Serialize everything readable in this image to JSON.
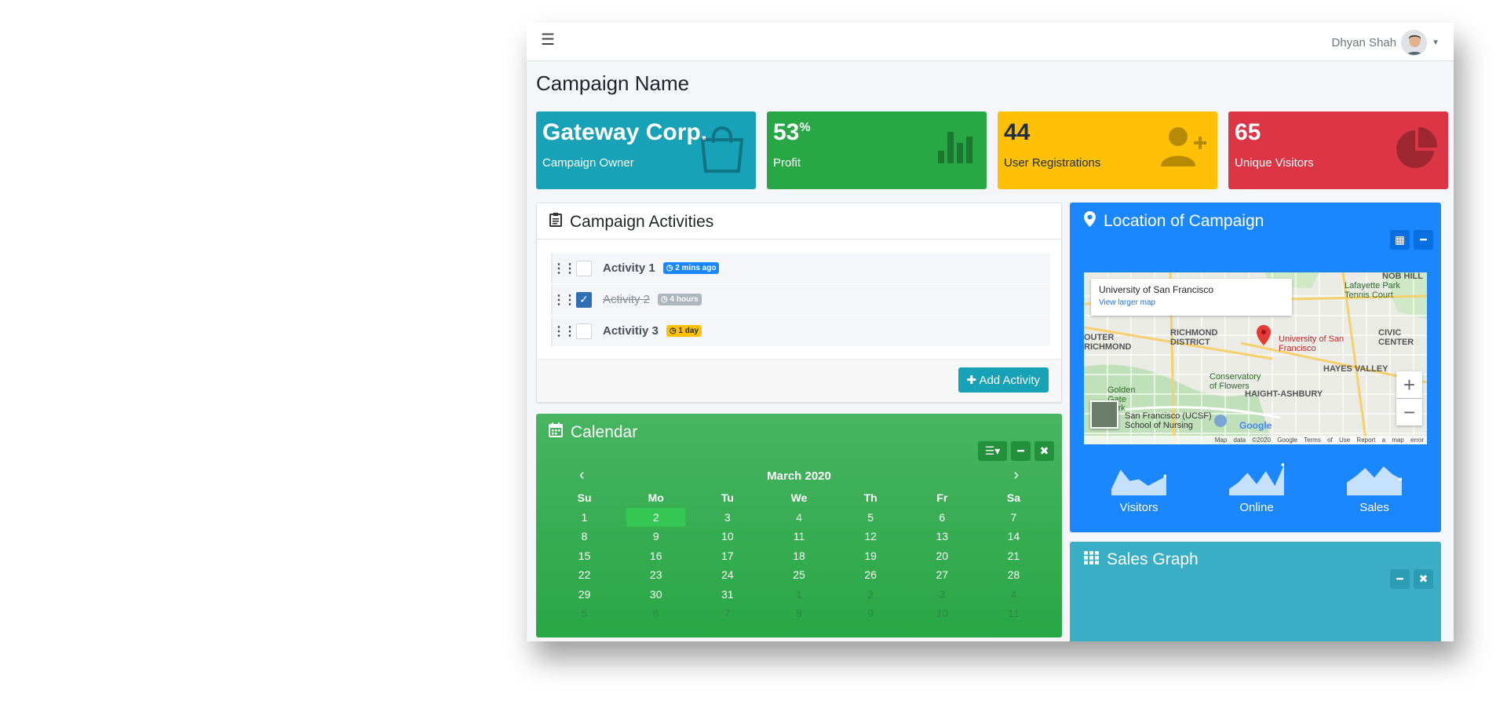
{
  "topbar": {
    "user_name": "Dhyan Shah"
  },
  "page_title": "Campaign Name",
  "info_boxes": [
    {
      "value": "Gateway Corp.",
      "label": "Campaign Owner",
      "color": "#17a2b8",
      "icon": "shopping-bag-icon"
    },
    {
      "value": "53",
      "unit": "%",
      "label": "Profit",
      "color": "#28a745",
      "icon": "bar-chart-icon"
    },
    {
      "value": "44",
      "label": "User Registrations",
      "color": "#ffc107",
      "icon": "user-plus-icon"
    },
    {
      "value": "65",
      "label": "Unique Visitors",
      "color": "#dc3545",
      "icon": "pie-chart-icon"
    }
  ],
  "activities": {
    "title": "Campaign Activities",
    "items": [
      {
        "label": "Activity 1",
        "time": "2 mins ago",
        "badge_color": "#1a87ff",
        "done": false
      },
      {
        "label": "Activity 2",
        "time": "4 hours",
        "badge_color": "#adb5bd",
        "done": true
      },
      {
        "label": "Activitiy 3",
        "time": "1 day",
        "badge_color": "#ffc107",
        "done": false
      }
    ],
    "add_button": "Add Activity"
  },
  "calendar": {
    "title": "Calendar",
    "month": "March 2020",
    "weekdays": [
      "Su",
      "Mo",
      "Tu",
      "We",
      "Th",
      "Fr",
      "Sa"
    ],
    "weeks": [
      [
        "1",
        "2",
        "3",
        "4",
        "5",
        "6",
        "7"
      ],
      [
        "8",
        "9",
        "10",
        "11",
        "12",
        "13",
        "14"
      ],
      [
        "15",
        "16",
        "17",
        "18",
        "19",
        "20",
        "21"
      ],
      [
        "22",
        "23",
        "24",
        "25",
        "26",
        "27",
        "28"
      ],
      [
        "29",
        "30",
        "31",
        "1",
        "2",
        "3",
        "4"
      ],
      [
        "5",
        "6",
        "7",
        "8",
        "9",
        "10",
        "11"
      ]
    ],
    "selected_day": "2"
  },
  "location": {
    "title": "Location of Campaign",
    "map": {
      "place": "University of San Francisco",
      "link": "View larger map",
      "pin_label": "University of San Francisco",
      "areas": [
        "RICHMOND DISTRICT",
        "OUTER RICHMOND",
        "HAIGHT-ASHBURY",
        "HAYES VALLEY",
        "CIVIC CENTER",
        "NOB HILL",
        "Lafayette Park Tennis Court",
        "Conservatory of Flowers",
        "Golden Gate Park",
        "San Francisco (UCSF) School of Nursing",
        "Google"
      ],
      "footer": "Map data ©2020 Google  Terms of Use  Report a map error"
    },
    "sparklines": [
      {
        "label": "Visitors",
        "values": [
          20,
          80,
          45,
          50,
          30,
          45,
          60
        ]
      },
      {
        "label": "Online",
        "values": [
          20,
          40,
          70,
          35,
          75,
          30,
          95
        ]
      },
      {
        "label": "Sales",
        "values": [
          40,
          60,
          85,
          55,
          90,
          65,
          50
        ]
      }
    ]
  },
  "sales_graph": {
    "title": "Sales Graph"
  },
  "colors": {
    "primary": "#1a87ff",
    "success": "#28a745",
    "info": "#17a2b8",
    "warning": "#ffc107",
    "danger": "#dc3545"
  }
}
